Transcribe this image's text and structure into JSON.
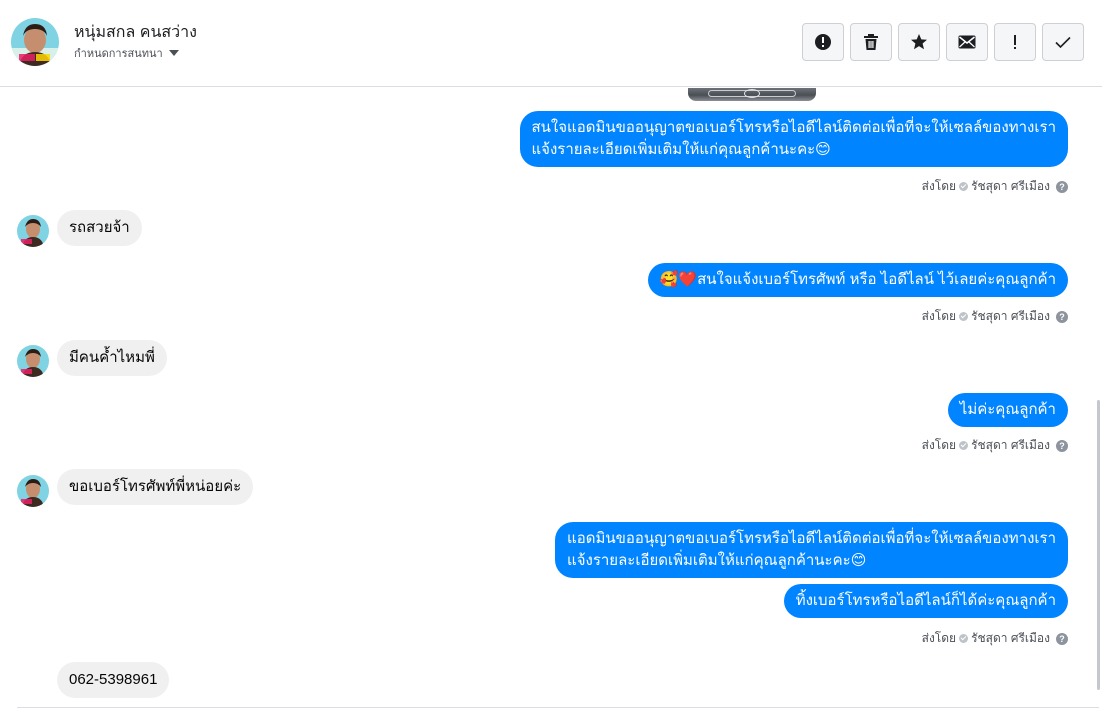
{
  "header": {
    "contact_name": "หนุ่มสกล คนสว่าง",
    "subtitle": "กำหนดการสนทนา",
    "avatar": "profile-photo"
  },
  "toolbar": {
    "buttons": [
      {
        "icon": "alert-circle-icon"
      },
      {
        "icon": "trash-icon"
      },
      {
        "icon": "star-icon"
      },
      {
        "icon": "envelope-icon"
      },
      {
        "icon": "exclamation-icon"
      },
      {
        "icon": "check-icon"
      }
    ]
  },
  "thread": {
    "photo_attachment": "car-photo",
    "sent_by_prefix": "ส่งโดย",
    "sent_by_name": "รัชสุดา ศรีเมือง",
    "messages": [
      {
        "from": "page",
        "lines": [
          "สนใจแอดมินขออนุญาตขอเบอร์โทรหรือไอดีไลน์ติดต่อเพื่อที่จะให้เซลล์ของทางเรา",
          "แจ้งรายละเอียดเพิ่มเติมให้แก่คุณลูกค้านะคะ😊"
        ]
      },
      {
        "from": "customer",
        "text": "รถสวยจ้า"
      },
      {
        "from": "page",
        "text": "🥰❤️สนใจแจ้งเบอร์โทรศัพท์ หรือ ไอดีไลน์  ไว้เลยค่ะคุณลูกค้า"
      },
      {
        "from": "customer",
        "text": "มีคนค้ำไหมพี่"
      },
      {
        "from": "page",
        "text": "ไม่ค่ะคุณลูกค้า"
      },
      {
        "from": "customer",
        "text": "ขอเบอร์โทรศัพท์พี่หน่อยค่ะ"
      },
      {
        "from": "page",
        "lines": [
          "แอดมินขออนุญาตขอเบอร์โทรหรือไอดีไลน์ติดต่อเพื่อที่จะให้เซลล์ของทางเรา",
          "แจ้งรายละเอียดเพิ่มเติมให้แก่คุณลูกค้านะคะ😊"
        ]
      },
      {
        "from": "page",
        "text": "ทิ้งเบอร์โทรหรือไอดีไลน์ก็ได้ค่ะคุณลูกค้า"
      },
      {
        "from": "customer",
        "text": "062-5398961"
      }
    ]
  },
  "colors": {
    "outgoing_bubble": "#0084ff",
    "incoming_bubble": "#f1f0f0",
    "border": "#dadde1"
  }
}
